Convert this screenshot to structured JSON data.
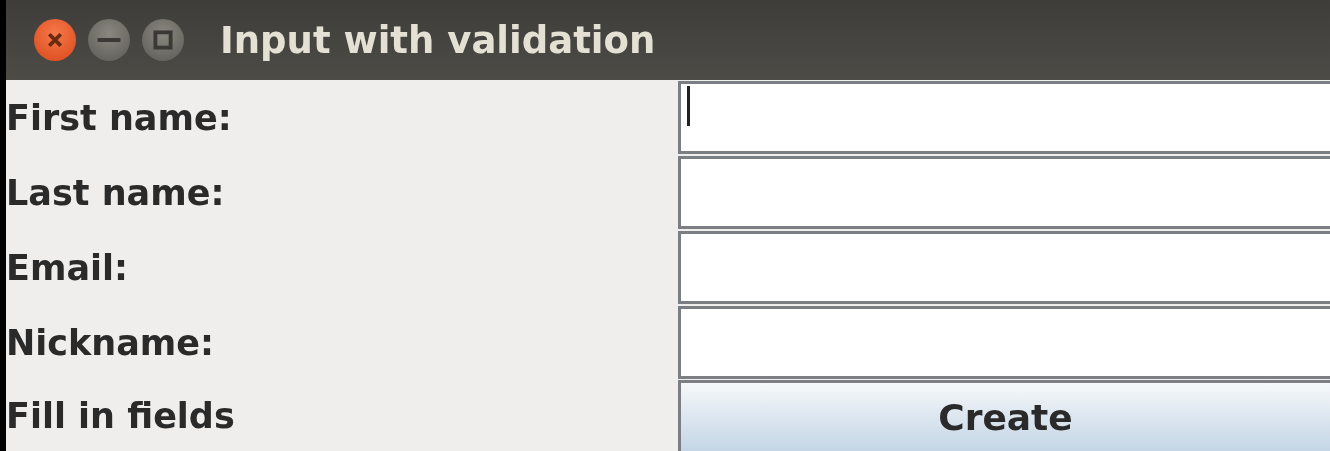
{
  "window": {
    "title": "Input with validation"
  },
  "fields": [
    {
      "label": "First name:",
      "focused": true
    },
    {
      "label": "Last name:",
      "focused": false
    },
    {
      "label": "Email:",
      "focused": false
    },
    {
      "label": "Nickname:",
      "focused": false
    }
  ],
  "status": "Fill in fields",
  "buttons": [
    "Create"
  ]
}
